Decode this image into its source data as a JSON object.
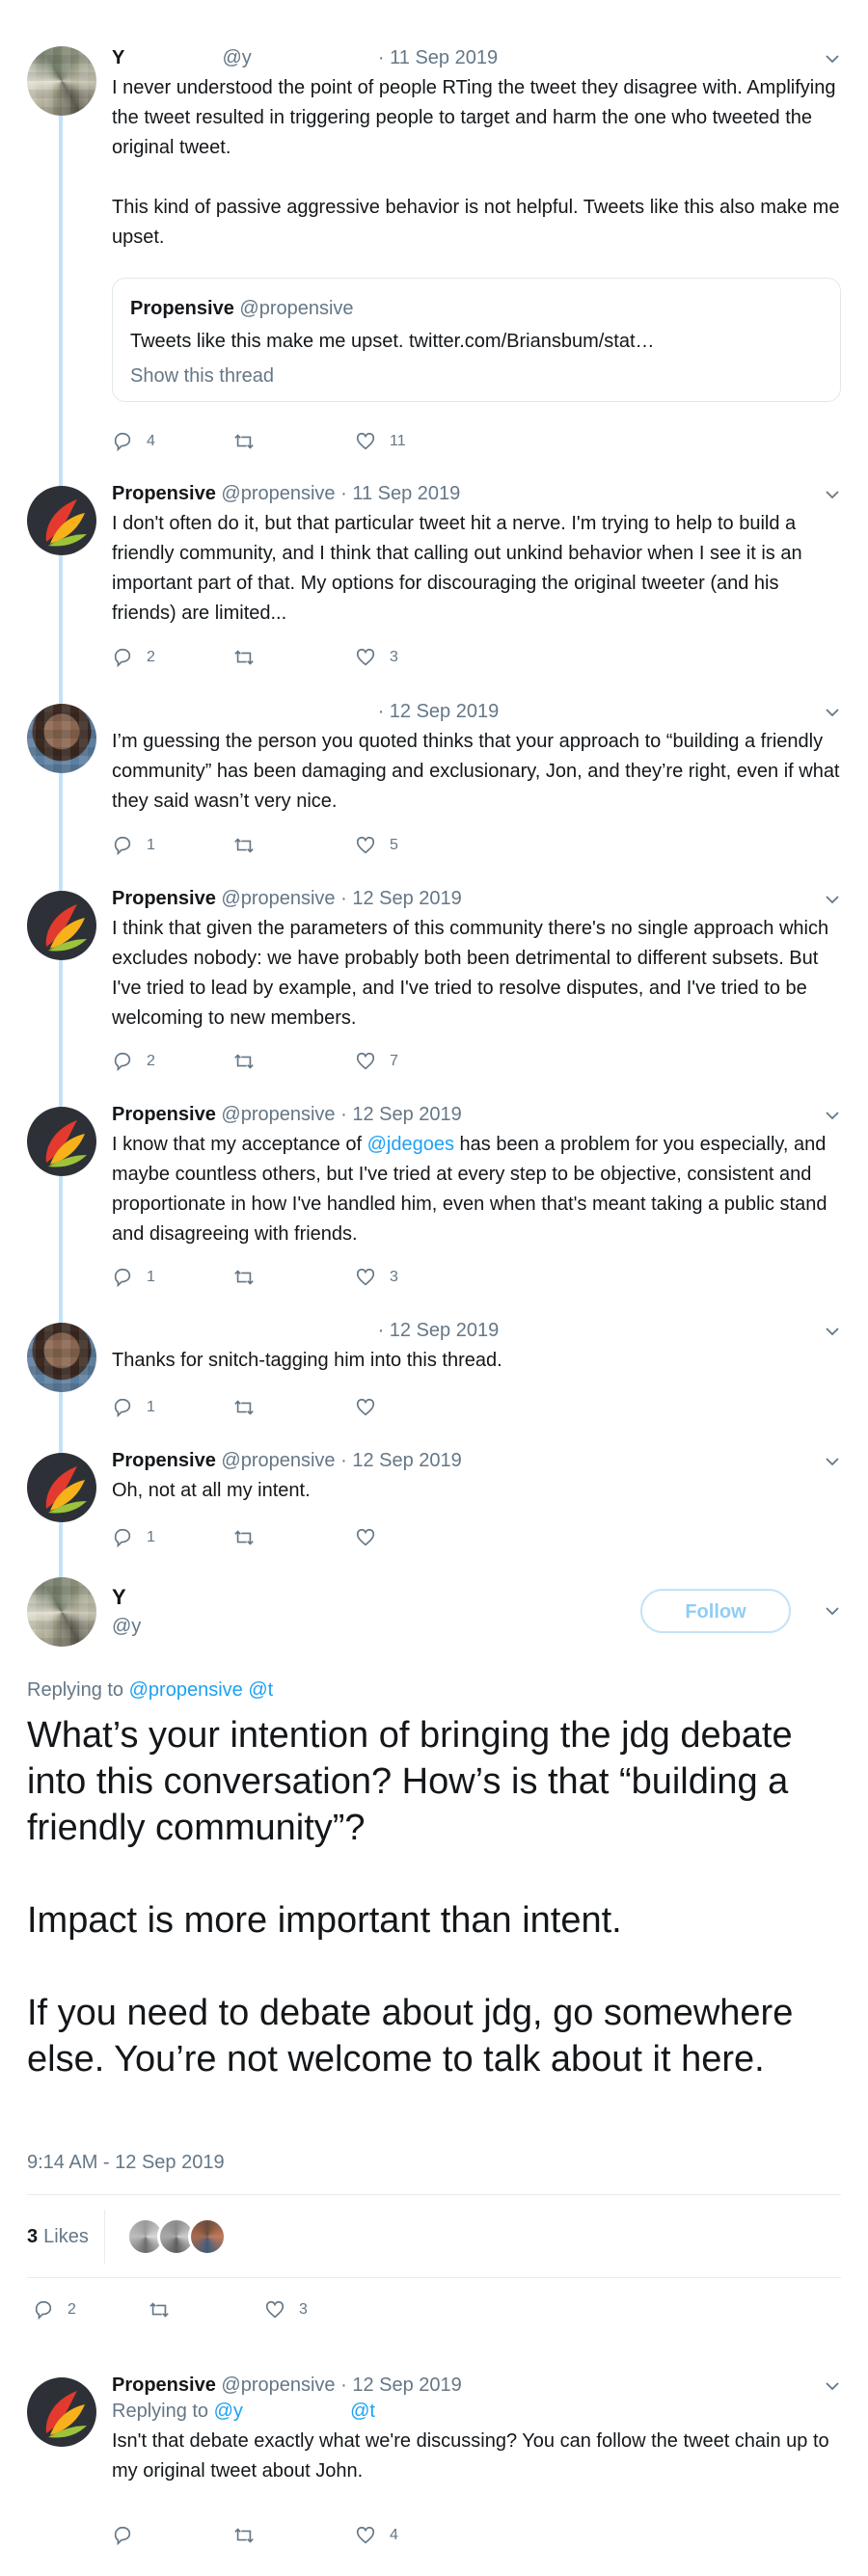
{
  "tweets": [
    {
      "name": "Y",
      "handle": "@y",
      "date": "· 11 Sep 2019",
      "text_p1": "I never understood the point of people RTing the tweet they disagree with. Amplifying the tweet resulted in triggering people to target and harm the one who tweeted the original tweet.",
      "text_p2": "This kind of passive aggressive behavior is not helpful. Tweets like this also make me upset.",
      "quote": {
        "name": "Propensive",
        "handle": "@propensive",
        "text": "Tweets like this make me upset. twitter.com/Briansbum/stat…",
        "show_thread": "Show this thread"
      },
      "replies": "4",
      "retweets": "",
      "likes": "11"
    },
    {
      "name": "Propensive",
      "handle": "@propensive",
      "date": "· 11 Sep 2019",
      "text": "I don't often do it, but that particular tweet hit a nerve. I'm trying to help to build a friendly community, and I think that calling out unkind behavior when I see it is an important part of that. My options for discouraging the original tweeter (and his friends) are limited...",
      "replies": "2",
      "retweets": "",
      "likes": "3"
    },
    {
      "name": "",
      "handle": "",
      "date": "· 12 Sep 2019",
      "text": "I’m guessing the person you quoted thinks that your approach to “building a friendly community” has been damaging and exclusionary, Jon, and they’re right, even if what they said wasn’t very nice.",
      "replies": "1",
      "retweets": "",
      "likes": "5"
    },
    {
      "name": "Propensive",
      "handle": "@propensive",
      "date": "· 12 Sep 2019",
      "text": "I think that given the parameters of this community there's no single approach which excludes nobody: we have probably both been detrimental to different subsets. But I've tried to lead by example, and I've tried to resolve disputes, and I've tried to be welcoming to new members.",
      "replies": "2",
      "retweets": "",
      "likes": "7"
    },
    {
      "name": "Propensive",
      "handle": "@propensive",
      "date": "· 12 Sep 2019",
      "text_before": "I know that my acceptance of ",
      "mention": "@jdegoes",
      "text_after": " has been a problem for you especially, and maybe countless others, but I've tried at every step to be objective, consistent and proportionate in how I've handled him, even when that's meant taking a public stand and disagreeing with friends.",
      "replies": "1",
      "retweets": "",
      "likes": "3"
    },
    {
      "name": "",
      "handle": "",
      "date": "· 12 Sep 2019",
      "text": "Thanks for snitch-tagging him into this thread.",
      "replies": "1",
      "retweets": "",
      "likes": ""
    },
    {
      "name": "Propensive",
      "handle": "@propensive",
      "date": "· 12 Sep 2019",
      "text": "Oh, not at all my intent.",
      "replies": "1",
      "retweets": "",
      "likes": ""
    }
  ],
  "focus": {
    "name": "Y",
    "handle": "@y",
    "follow_label": "Follow",
    "replying_prefix": "Replying to",
    "replying_to_1": "@propensive",
    "replying_to_2": "@t",
    "text_p1": "What’s your intention of bringing the jdg debate into this conversation? How’s is that “building a friendly community”?",
    "text_p2": "Impact is more important than intent.",
    "text_p3": "If you need to debate about jdg, go somewhere else. You’re not welcome to talk about it here.",
    "timestamp": "9:14 AM - 12 Sep 2019",
    "likes_count": "3",
    "likes_label": "Likes",
    "replies": "2",
    "retweets": "",
    "likes": "3"
  },
  "last_reply": {
    "name": "Propensive",
    "handle": "@propensive",
    "date": "· 12 Sep 2019",
    "replying_prefix": "Replying to",
    "replying_to_1": "@y",
    "replying_to_2": "@t",
    "text": "Isn't that debate exactly what we're discussing? You can follow the tweet chain up to my original tweet about John.",
    "replies": "",
    "retweets": "",
    "likes": "4"
  },
  "colors": {
    "accent": "#1da1f2",
    "muted": "#657786",
    "thread": "#c4e2f7",
    "text": "#14171a"
  }
}
